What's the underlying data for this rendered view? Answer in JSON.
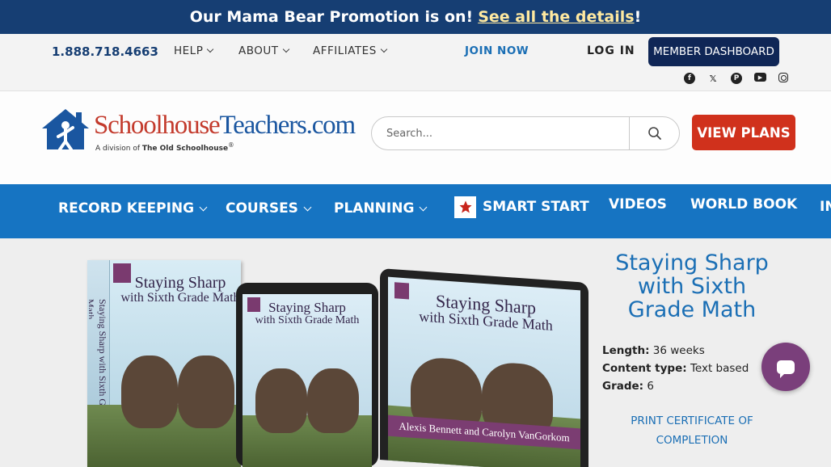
{
  "promo": {
    "text": "Our Mama Bear Promotion is on!",
    "link": "See all the details",
    "suffix": "!"
  },
  "utility": {
    "phone": "1.888.718.4663",
    "links": [
      "HELP",
      "ABOUT",
      "AFFILIATES"
    ],
    "join": "JOIN NOW",
    "login": "LOG IN",
    "dashboard": "MEMBER DASHBOARD",
    "socials": [
      "facebook-icon",
      "x-icon",
      "pinterest-icon",
      "youtube-icon",
      "instagram-icon"
    ]
  },
  "header": {
    "logo_part1": "Schoolhouse",
    "logo_part2": "Teachers.com",
    "logo_sub_prefix": "A division of ",
    "logo_sub_bold": "The Old Schoolhouse",
    "logo_sub_mark": "®",
    "search_placeholder": "Search...",
    "view_plans": "VIEW PLANS"
  },
  "nav": {
    "items": [
      "RECORD KEEPING",
      "COURSES",
      "PLANNING",
      "SMART START",
      "VIDEOS",
      "WORLD BOOK",
      "IN"
    ]
  },
  "product": {
    "cover_title_line1": "Staying Sharp",
    "cover_title_line2": "with Sixth Grade Math",
    "spine_text": "Staying Sharp with Sixth Grade Math",
    "authors": "Alexis Bennett and Carolyn VanGorkom",
    "title": "Staying Sharp with Sixth Grade Math",
    "length_label": "Length:",
    "length_value": "36 weeks",
    "content_label": "Content type:",
    "content_value": "Text based",
    "grade_label": "Grade:",
    "grade_value": "6",
    "certificate": "PRINT CERTIFICATE OF COMPLETION"
  },
  "colors": {
    "promo_bg": "#163e73",
    "nav_bg": "#1674c2",
    "plans_bg": "#d0311c",
    "dashboard_bg": "#0f2656",
    "chat_bg": "#7a3f7b",
    "link": "#1b6fb5"
  }
}
